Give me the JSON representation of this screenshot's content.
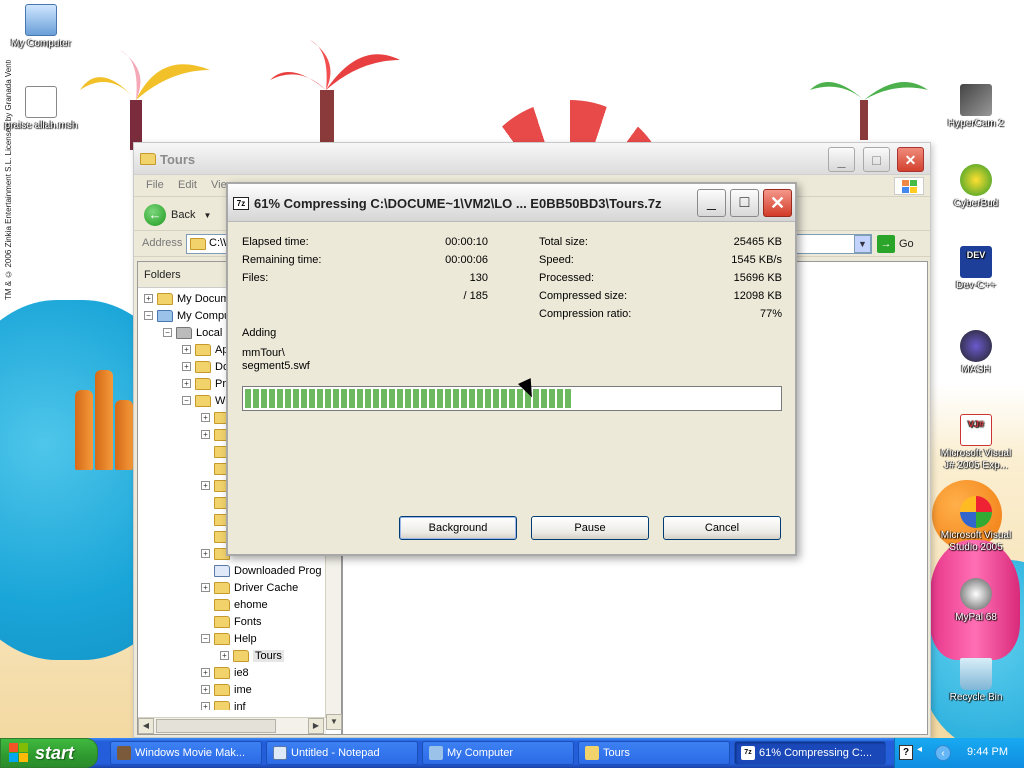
{
  "desktop": {
    "watermark": "TM & © 2006 Zinkia Entertainment S.L. Licensed by Granada Ventures Ltd.",
    "icons": [
      {
        "label": "My Computer"
      },
      {
        "label": "praise allah.msh"
      },
      {
        "label": "HyperCam 2"
      },
      {
        "label": "CyberBud"
      },
      {
        "label": "Dev-C++"
      },
      {
        "label": "MASH"
      },
      {
        "label": "Microsoft Visual J# 2005 Exp..."
      },
      {
        "label": "Microsoft Visual Studio 2005"
      },
      {
        "label": "MyPal 68"
      },
      {
        "label": "Recycle Bin"
      }
    ]
  },
  "explorer": {
    "title": "Tours",
    "menu": [
      "File",
      "Edit",
      "View"
    ],
    "back_label": "Back",
    "address_label": "Address",
    "address_value": "C:\\W",
    "go_label": "Go",
    "folders_label": "Folders",
    "tree": [
      {
        "label": "My Docum"
      },
      {
        "label": "My Compu"
      },
      {
        "label": "Local D"
      },
      {
        "label": "Ap"
      },
      {
        "label": "Do"
      },
      {
        "label": "Pr"
      },
      {
        "label": "W"
      },
      {
        "label": "Downloaded Prog"
      },
      {
        "label": "Driver Cache"
      },
      {
        "label": "ehome"
      },
      {
        "label": "Fonts"
      },
      {
        "label": "Help"
      },
      {
        "label": "Tours"
      },
      {
        "label": "ie8"
      },
      {
        "label": "ime"
      },
      {
        "label": "inf"
      }
    ]
  },
  "dialog": {
    "title": "61% Compressing C:\\DOCUME~1\\VM2\\LO ... E0BB50BD3\\Tours.7z",
    "app_icon": "7z",
    "left_stats": [
      {
        "label": "Elapsed time:",
        "value": "00:00:10"
      },
      {
        "label": "Remaining time:",
        "value": "00:00:06"
      },
      {
        "label": "Files:",
        "value": "130"
      },
      {
        "label": "",
        "value": "/ 185"
      }
    ],
    "right_stats": [
      {
        "label": "Total size:",
        "value": "25465 KB"
      },
      {
        "label": "Speed:",
        "value": "1545 KB/s"
      },
      {
        "label": "Processed:",
        "value": "15696 KB"
      },
      {
        "label": "Compressed size:",
        "value": "12098 KB"
      },
      {
        "label": "Compression ratio:",
        "value": "77%"
      }
    ],
    "action": "Adding",
    "current_path": "mmTour\\",
    "current_file": "segment5.swf",
    "progress_fraction": 0.61,
    "buttons": {
      "background": "Background",
      "pause": "Pause",
      "cancel": "Cancel"
    }
  },
  "taskbar": {
    "start_label": "start",
    "tasks": [
      {
        "label": "Windows Movie Mak..."
      },
      {
        "label": "Untitled - Notepad"
      },
      {
        "label": "My Computer"
      },
      {
        "label": "Tours"
      },
      {
        "label": "61% Compressing C:..."
      }
    ],
    "clock": "9:44 PM",
    "help_glyph": "?"
  },
  "colors": {
    "xp_blue": "#245edb",
    "start_green": "#3fb93f",
    "progress_green": "#6db95f",
    "close_red": "#d23b28"
  }
}
